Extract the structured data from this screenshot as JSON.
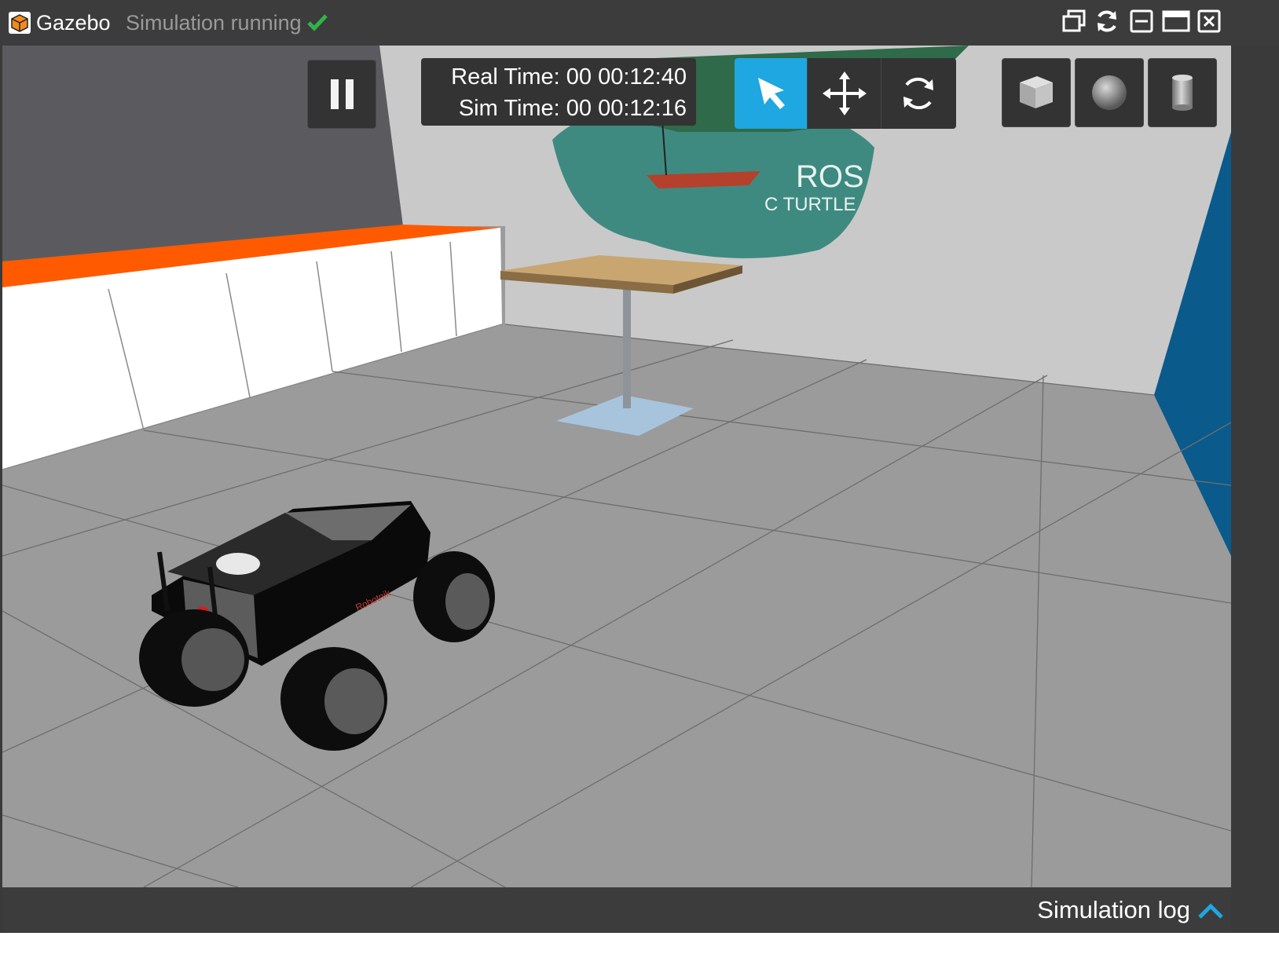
{
  "app": {
    "name": "Gazebo",
    "status": "Simulation running"
  },
  "window_controls": [
    "restore-icon",
    "refresh-icon",
    "minimize-icon",
    "maximize-icon",
    "close-icon"
  ],
  "time_panel": {
    "real_time": "Real Time: 00 00:12:40",
    "sim_time": "Sim Time: 00 00:12:16"
  },
  "toolbar": {
    "active_mode": "select",
    "modes": [
      "select",
      "translate",
      "rotate"
    ],
    "shapes": [
      "box",
      "sphere",
      "cylinder"
    ]
  },
  "scene": {
    "poster_text_1": "ROS",
    "poster_text_2": "C TURTLE",
    "robot_brand": "Robotnik"
  },
  "bottom_bar": {
    "log_label": "Simulation log"
  },
  "colors": {
    "accent": "#1ea7e0",
    "status_check": "#2fb34a",
    "floor": "#9a9a9a",
    "wall_orange": "#ff5a00",
    "wall_blue": "#0a5a8c"
  }
}
